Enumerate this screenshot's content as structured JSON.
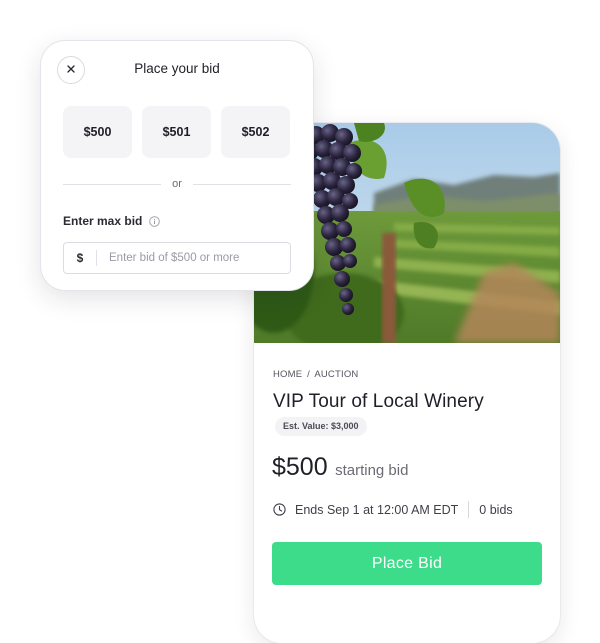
{
  "modal": {
    "title": "Place your bid",
    "close_icon": "close-icon",
    "bid_options": [
      "$500",
      "$501",
      "$502"
    ],
    "or_label": "or",
    "max_bid_label": "Enter max bid",
    "info_icon": "info-icon",
    "currency_symbol": "$",
    "max_bid_value": "",
    "max_bid_placeholder": "Enter bid of $500 or more"
  },
  "listing": {
    "breadcrumb": [
      "HOME",
      "AUCTION"
    ],
    "breadcrumb_separator": "/",
    "title": "VIP Tour of Local Winery",
    "est_value": "Est. Value: $3,000",
    "price": "$500",
    "price_sub": "starting bid",
    "clock_icon": "clock-icon",
    "ends": "Ends Sep 1 at 12:00 AM EDT",
    "bids": "0 bids",
    "place_bid_label": "Place Bid"
  },
  "colors": {
    "accent_green": "#3ddc8a",
    "option_bg": "#f4f4f7",
    "text_dark": "#1f1f28"
  }
}
